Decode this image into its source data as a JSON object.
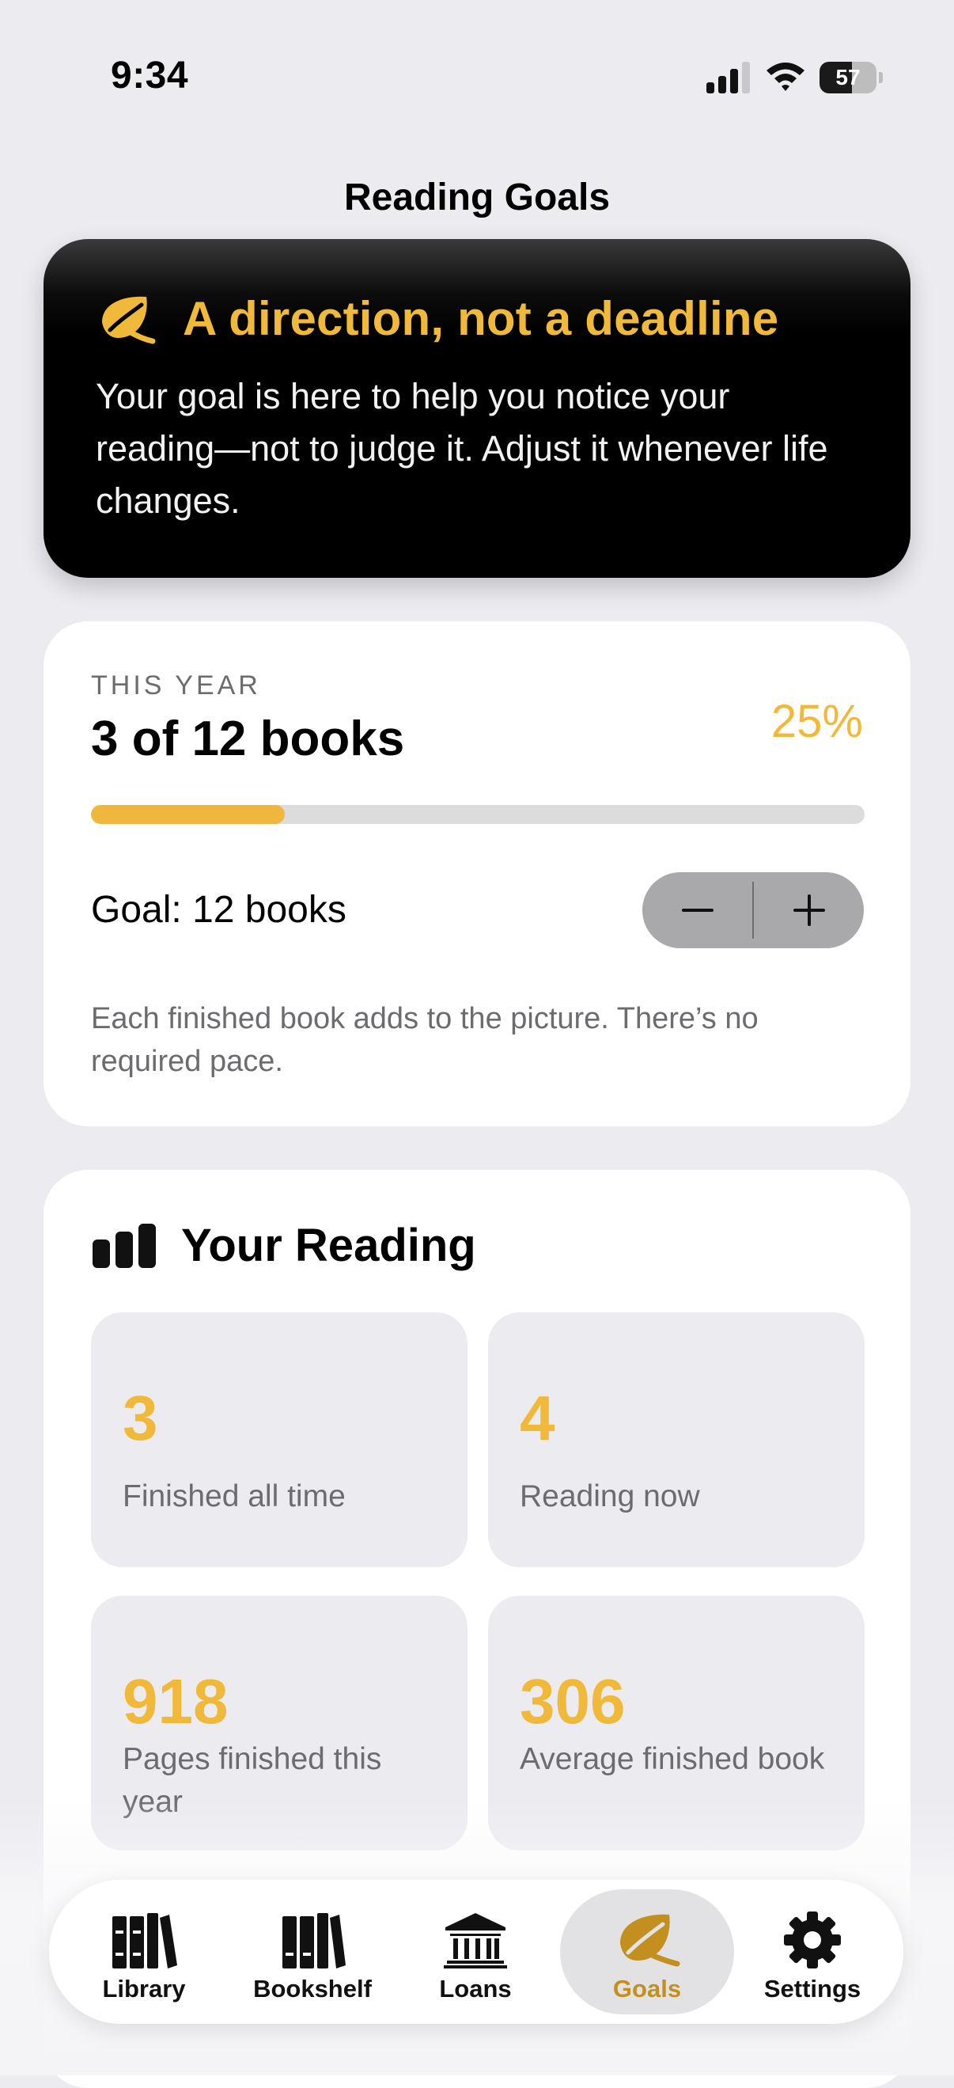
{
  "status_bar": {
    "time": "9:34",
    "battery_level": "57",
    "icons": [
      "signal-icon",
      "wifi-icon",
      "battery-icon"
    ]
  },
  "nav": {
    "title": "Reading Goals"
  },
  "banner": {
    "icon": "leaf-icon",
    "title": "A direction, not a deadline",
    "body": "Your goal is here to help you notice your reading—not to judge it. Adjust it whenever life changes."
  },
  "goal_card": {
    "eyebrow": "THIS YEAR",
    "progress_text": "3 of 12 books",
    "percent_text": "25%",
    "progress_fraction": 0.25,
    "goal_label": "Goal: 12 books",
    "stepper": {
      "decrement_label": "−",
      "increment_label": "+"
    },
    "note": "Each finished book adds to the picture. There’s no required pace."
  },
  "reading_card": {
    "icon": "bar-chart-icon",
    "title": "Your Reading",
    "stats": [
      {
        "value": "3",
        "label": "Finished all time"
      },
      {
        "value": "4",
        "label": "Reading now"
      },
      {
        "value": "918",
        "label": "Pages finished this year"
      },
      {
        "value": "306",
        "label": "Average finished book"
      }
    ]
  },
  "tab_bar": {
    "items": [
      {
        "label": "Library",
        "icon": "library-books-icon"
      },
      {
        "label": "Bookshelf",
        "icon": "bookshelf-icon"
      },
      {
        "label": "Loans",
        "icon": "bank-building-icon"
      },
      {
        "label": "Goals",
        "icon": "leaf-icon",
        "active": true
      },
      {
        "label": "Settings",
        "icon": "gear-icon"
      }
    ]
  },
  "colors": {
    "accent": "#F0B93A",
    "accent_dark": "#C38F1F",
    "background": "#EBEBF0",
    "card": "#FFFFFF",
    "banner": "#000000",
    "secondary_text": "#6C6C70"
  }
}
